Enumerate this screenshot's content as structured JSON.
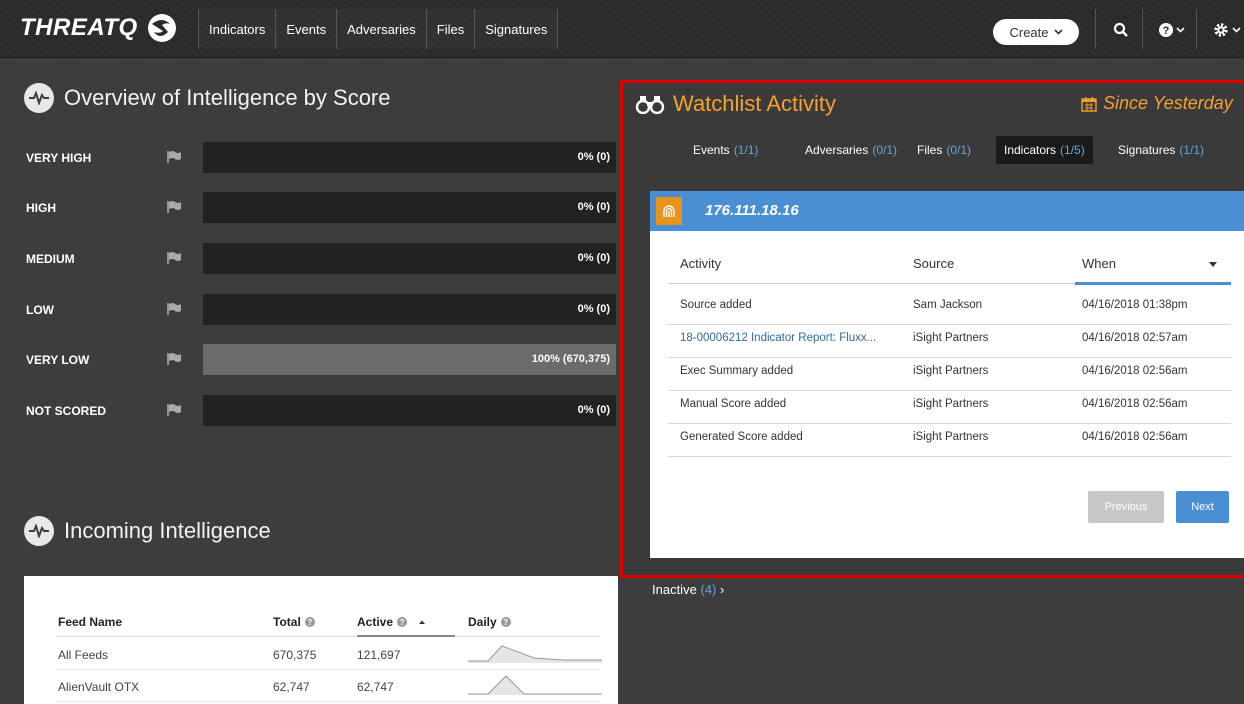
{
  "nav": {
    "logo": "THREATQ",
    "links": [
      "Indicators",
      "Events",
      "Adversaries",
      "Files",
      "Signatures"
    ],
    "create_label": "Create",
    "icons": [
      "search-icon",
      "help-icon",
      "gear-icon"
    ]
  },
  "overview": {
    "title": "Overview of Intelligence by Score",
    "scores": [
      {
        "label": "VERY HIGH",
        "value": "0% (0)",
        "fill": 0
      },
      {
        "label": "HIGH",
        "value": "0% (0)",
        "fill": 0
      },
      {
        "label": "MEDIUM",
        "value": "0% (0)",
        "fill": 0
      },
      {
        "label": "LOW",
        "value": "0% (0)",
        "fill": 0
      },
      {
        "label": "VERY LOW",
        "value": "100% (670,375)",
        "fill": 1
      },
      {
        "label": "NOT SCORED",
        "value": "0% (0)",
        "fill": 0
      }
    ]
  },
  "incoming": {
    "title": "Incoming Intelligence",
    "headers": [
      "Feed Name",
      "Total",
      "Active",
      "Daily"
    ],
    "rows": [
      {
        "name": "All Feeds",
        "total": "670,375",
        "active": "121,697"
      },
      {
        "name": "AlienVault OTX",
        "total": "62,747",
        "active": "62,747"
      }
    ]
  },
  "watchlist": {
    "title": "Watchlist Activity",
    "since": "Since Yesterday",
    "tabs": [
      {
        "label": "Events",
        "count": "(1/1)"
      },
      {
        "label": "Adversaries",
        "count": "(0/1)"
      },
      {
        "label": "Files",
        "count": "(0/1)"
      },
      {
        "label": "Indicators",
        "count": "(1/5)"
      },
      {
        "label": "Signatures",
        "count": "(1/1)"
      }
    ],
    "indicator": "176.111.18.16",
    "columns": [
      "Activity",
      "Source",
      "When"
    ],
    "rows": [
      {
        "activity": "Source added",
        "source": "Sam Jackson",
        "when": "04/16/2018 01:38pm"
      },
      {
        "activity": "18-00006212 Indicator Report: Fluxx...",
        "source": "iSight Partners",
        "when": "04/16/2018 02:57am"
      },
      {
        "activity": "Exec Summary added",
        "source": "iSight Partners",
        "when": "04/16/2018 02:56am"
      },
      {
        "activity": "Manual Score added",
        "source": "iSight Partners",
        "when": "04/16/2018 02:56am"
      },
      {
        "activity": "Generated Score added",
        "source": "iSight Partners",
        "when": "04/16/2018 02:56am"
      }
    ],
    "prev_label": "Previous",
    "next_label": "Next",
    "inactive_label": "Inactive",
    "inactive_count": "(4)"
  }
}
